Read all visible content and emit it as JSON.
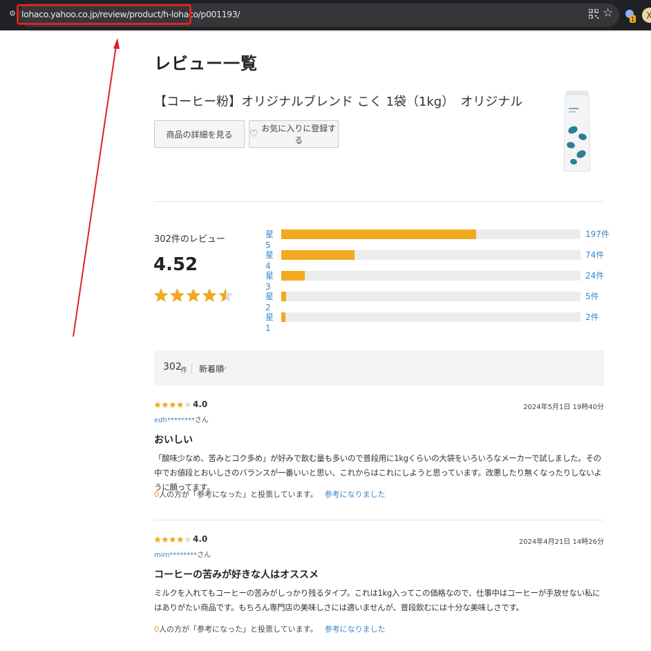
{
  "browser": {
    "url": "lohaco.yahoo.co.jp/review/product/h-lohaco/p001193/",
    "site_info_icon": "tune-icon",
    "qr_icon": "qr-code-icon",
    "bookmark_icon": "star-outline-icon",
    "extension_badge": "1",
    "extension2_letter": "X"
  },
  "colors": {
    "accent_orange": "#f2a91f",
    "link_blue": "#3d86c6",
    "annotation_red": "#e02020"
  },
  "page": {
    "title": "レビュー一覧",
    "product_name": "【コーヒー粉】オリジナルブレンド こく 1袋（1kg）　オリジナル",
    "buttons": {
      "details": "商品の詳細を見る",
      "favorite": "お気に入りに登録する"
    }
  },
  "summary": {
    "review_count_label": "302件のレビュー",
    "average": "4.52",
    "average_value": 4.52,
    "distribution": [
      {
        "label": "星5",
        "count": 197,
        "count_label": "197件"
      },
      {
        "label": "星4",
        "count": 74,
        "count_label": "74件"
      },
      {
        "label": "星3",
        "count": 24,
        "count_label": "24件"
      },
      {
        "label": "星2",
        "count": 5,
        "count_label": "5件"
      },
      {
        "label": "星1",
        "count": 2,
        "count_label": "2件"
      }
    ]
  },
  "sortbar": {
    "total": "302",
    "unit": "件",
    "sort": "新着順"
  },
  "reviews": [
    {
      "rating": 4,
      "score": "4.0",
      "date": "2024年5月1日 19時40分",
      "user": "edh********",
      "user_suffix": "さん",
      "title": "おいしい",
      "body": "「酸味少なめ、苦みとコク多め」が好みで飲む量も多いので普段用に1kgくらいの大袋をいろいろなメーカーで試しました。その中でお値段とおいしさのバランスが一番いいと思い、これからはこれにしようと思っています。改悪したり無くなったりしないように願ってます。",
      "helpful_count": "0",
      "helpful_text": "人の方が「参考になった」と投票しています。",
      "helpful_link": "参考になりました"
    },
    {
      "rating": 4,
      "score": "4.0",
      "date": "2024年4月21日 14時26分",
      "user": "mim********",
      "user_suffix": "さん",
      "title": "コーヒーの苦みが好きな人はオススメ",
      "body": "ミルクを入れてもコーヒーの苦みがしっかり残るタイプ。これは1kg入ってこの価格なので、仕事中はコーヒーが手放せない私にはありがたい商品です。もちろん専門店の美味しさには適いませんが、普段飲むには十分な美味しさです。",
      "helpful_count": "0",
      "helpful_text": "人の方が「参考になった」と投票しています。",
      "helpful_link": "参考になりました"
    }
  ]
}
